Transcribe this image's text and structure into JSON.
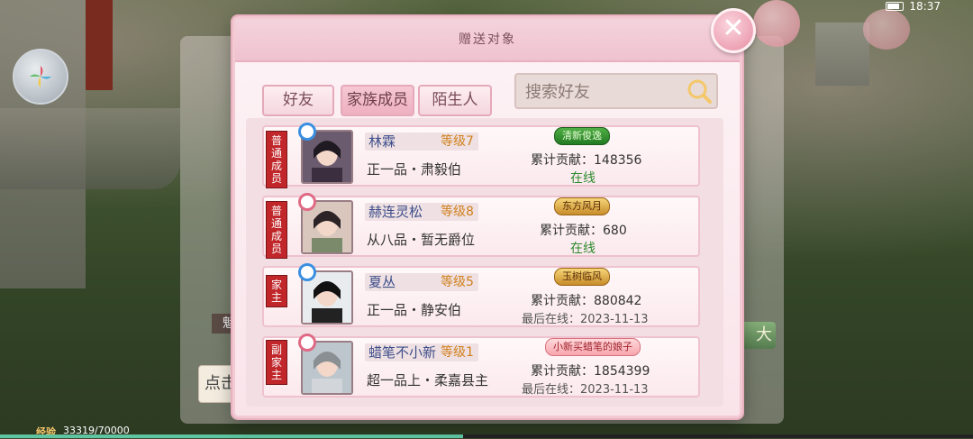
{
  "status_bar": {
    "time": "18:37"
  },
  "background": {
    "left_button_text": "点击",
    "right_button_text": "大",
    "dark_tag_text": "魁",
    "exp": {
      "label": "经验",
      "value": "33319/70000",
      "fill_fraction": 0.476
    }
  },
  "dialog": {
    "title": "赠送对象",
    "close_symbol": "✕",
    "tabs": [
      {
        "label": "好友",
        "active": false
      },
      {
        "label": "家族成员",
        "active": true
      },
      {
        "label": "陌生人",
        "active": false
      }
    ],
    "search": {
      "placeholder": "搜索好友",
      "value": ""
    },
    "members": [
      {
        "role": "普通成员",
        "gender": "male",
        "name": "林霖",
        "level": "等级7",
        "title": "正一品・肃毅伯",
        "badge": "清新俊逸",
        "badge_style": "green",
        "contribution": "累计贡献：148356",
        "status": "在线",
        "last_online": ""
      },
      {
        "role": "普通成员",
        "gender": "female",
        "name": "赫连灵松",
        "level": "等级8",
        "title": "从八品・暂无爵位",
        "badge": "东方风月",
        "badge_style": "gold",
        "contribution": "累计贡献：680",
        "status": "在线",
        "last_online": ""
      },
      {
        "role": "家主",
        "gender": "male",
        "name": "夏丛",
        "level": "等级5",
        "title": "正一品・静安伯",
        "badge": "玉树临风",
        "badge_style": "gold",
        "contribution": "累计贡献：880842",
        "status": "",
        "last_online": "最后在线：2023-11-13"
      },
      {
        "role": "副家主",
        "gender": "female",
        "name": "蜡笔不小新",
        "level": "等级1",
        "title": "超一品上・柔嘉县主",
        "badge": "小新买蜡笔的娘子",
        "badge_style": "pink",
        "contribution": "累计贡献：1854399",
        "status": "",
        "last_online": "最后在线：2023-11-13"
      }
    ]
  }
}
